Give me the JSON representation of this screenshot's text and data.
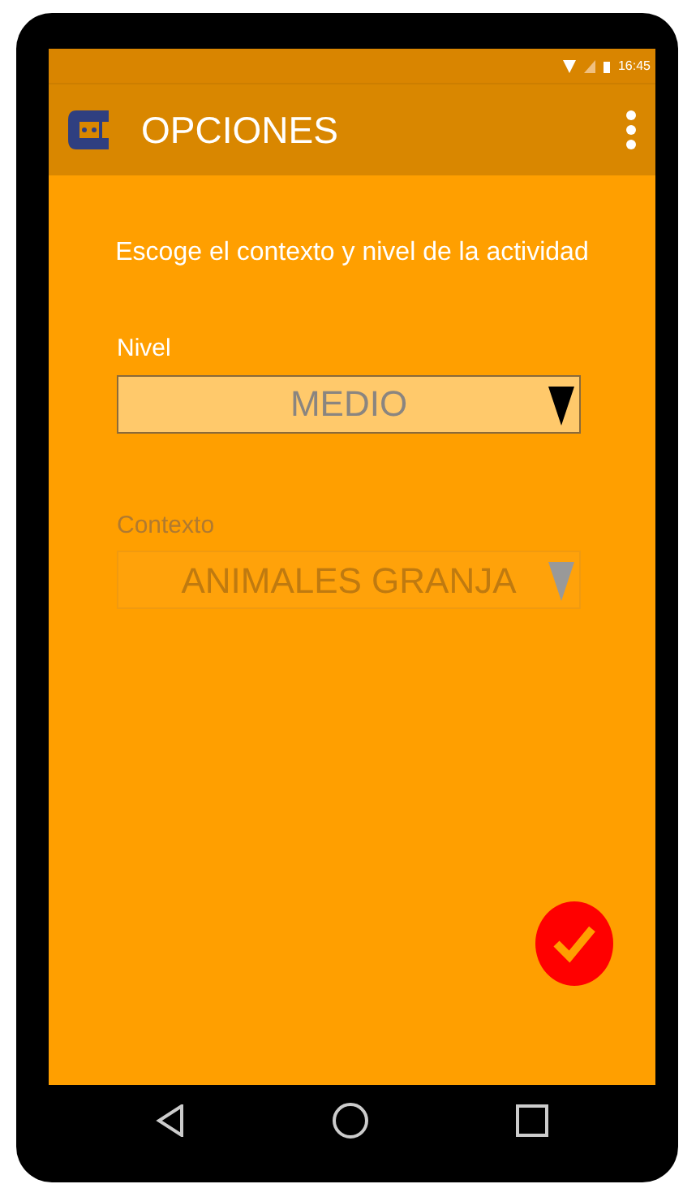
{
  "status_bar": {
    "time": "16:45"
  },
  "app_bar": {
    "title": "OPCIONES"
  },
  "prompt": "Escoge el contexto y nivel de la actividad",
  "fields": [
    {
      "label": "Nivel",
      "value": "MEDIO",
      "disabled": false
    },
    {
      "label": "Contexto",
      "value": "ANIMALES GRANJA",
      "disabled": true
    }
  ]
}
